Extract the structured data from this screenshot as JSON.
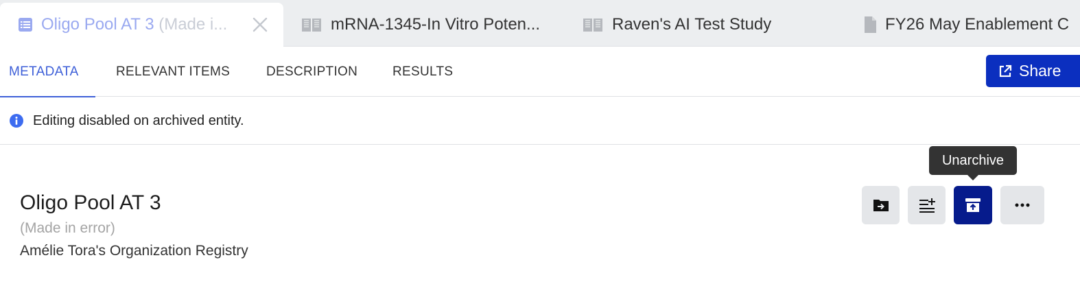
{
  "tabs": [
    {
      "title": "Oligo Pool AT 3",
      "suffix": "(Made i...",
      "icon": "list-document-icon",
      "active": true
    },
    {
      "title": "mRNA-1345-In Vitro Poten...",
      "icon": "notebook-icon",
      "active": false
    },
    {
      "title": "Raven's AI Test Study",
      "icon": "notebook-icon",
      "active": false
    },
    {
      "title": "FY26 May Enablement C",
      "icon": "file-icon",
      "active": false
    }
  ],
  "nav": {
    "items": [
      "METADATA",
      "RELEVANT ITEMS",
      "DESCRIPTION",
      "RESULTS"
    ],
    "active": "METADATA",
    "share_label": "Share"
  },
  "banner": {
    "text": "Editing disabled on archived entity.",
    "icon": "info-icon"
  },
  "entity": {
    "name": "Oligo Pool AT 3",
    "archive_reason": "(Made in error)",
    "registry": "Amélie Tora's Organization Registry"
  },
  "actions": {
    "buttons": [
      "move-to-folder-icon",
      "add-to-list-icon",
      "unarchive-icon",
      "more-icon"
    ],
    "tooltip": "Unarchive"
  },
  "colors": {
    "accent": "#3d5fd8",
    "share_bg": "#0b2fbf",
    "unarchive_bg": "#061b8c",
    "muted_tab_text": "#9aa9f0"
  }
}
